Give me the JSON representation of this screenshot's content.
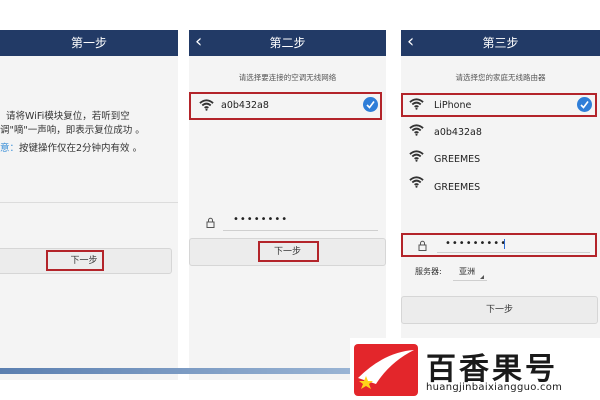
{
  "step1": {
    "title": "第一步",
    "line1": "请将WiFi模块复位，若听到空",
    "line2": "调\"嘀\"一声响，即表示复位成功 。",
    "note_label": "意：",
    "note_text": "按键操作仅在2分钟内有效 。",
    "next_button": "下一步"
  },
  "step2": {
    "title": "第二步",
    "subtitle": "请选择要连接的空调无线网络",
    "network": "a0b432a8",
    "password": "••••••••",
    "next_button": "下一步"
  },
  "step3": {
    "title": "第三步",
    "subtitle": "请选择您的家庭无线路由器",
    "networks": [
      "LiPhone",
      "a0b432a8",
      "GREEMES",
      "GREEMES"
    ],
    "password": "•••••••••",
    "server_label": "服务器:",
    "server_value": "亚洲",
    "next_button": "下一步"
  },
  "watermark": {
    "title": "百香果号",
    "url": "huangjinbaixiangguo.com"
  },
  "colors": {
    "header": "#223a66",
    "highlight": "#b3242a",
    "check": "#2f7ed8",
    "logo_red": "#e3262b"
  },
  "icons": [
    "back-arrow-icon",
    "wifi-icon",
    "lock-icon",
    "check-icon"
  ]
}
